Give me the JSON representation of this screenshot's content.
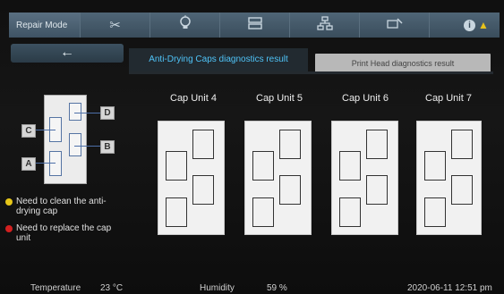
{
  "header": {
    "mode_label": "Repair Mode",
    "icons": [
      "scissors-icon",
      "lightbulb-icon",
      "tray-icon",
      "network-icon",
      "printer-tool-icon",
      "info-warning-icon"
    ]
  },
  "nav": {
    "back_label": "←"
  },
  "tabs": [
    {
      "label": "Anti-Drying Caps diagnostics result",
      "active": true
    },
    {
      "label": "Print Head diagnostics result",
      "active": false
    }
  ],
  "diagram": {
    "labels": [
      "D",
      "C",
      "B",
      "A"
    ]
  },
  "legend": [
    {
      "text": "Need to clean the anti-drying cap",
      "color": "#e6c619"
    },
    {
      "text": "Need to replace the cap unit",
      "color": "#d32020"
    }
  ],
  "cap_units": [
    {
      "title": "Cap Unit 4"
    },
    {
      "title": "Cap Unit 5"
    },
    {
      "title": "Cap Unit 6"
    },
    {
      "title": "Cap Unit 7"
    }
  ],
  "status": {
    "temperature_label": "Temperature",
    "temperature_value": "23 °C",
    "humidity_label": "Humidity",
    "humidity_value": "59 %",
    "datetime": "2020-06-11 12:51 pm"
  }
}
